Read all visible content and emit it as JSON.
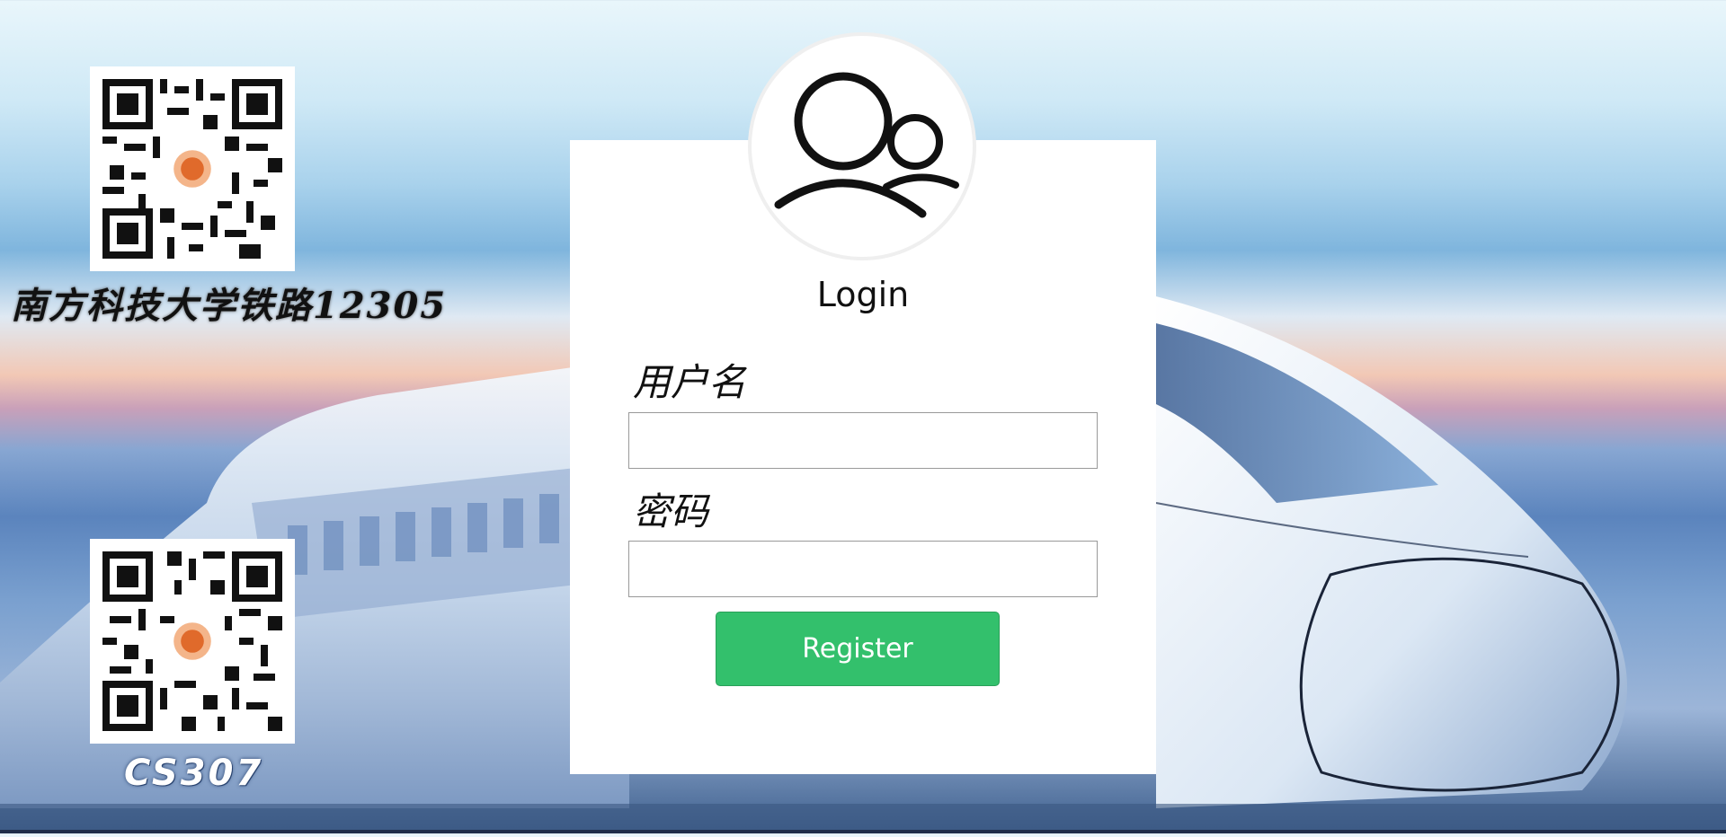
{
  "brand": {
    "title": "南方科技大学铁路12305",
    "course": "CS307"
  },
  "login": {
    "title": "Login",
    "username_label": "用户名",
    "password_label": "密码",
    "username_value": "",
    "password_value": "",
    "register_label": "Register"
  },
  "icons": {
    "avatar": "users-icon",
    "qr_top": "qr-code-icon",
    "qr_bottom": "qr-code-icon"
  },
  "colors": {
    "accent": "#33c06c",
    "panel": "#ffffff",
    "text": "#111111"
  }
}
